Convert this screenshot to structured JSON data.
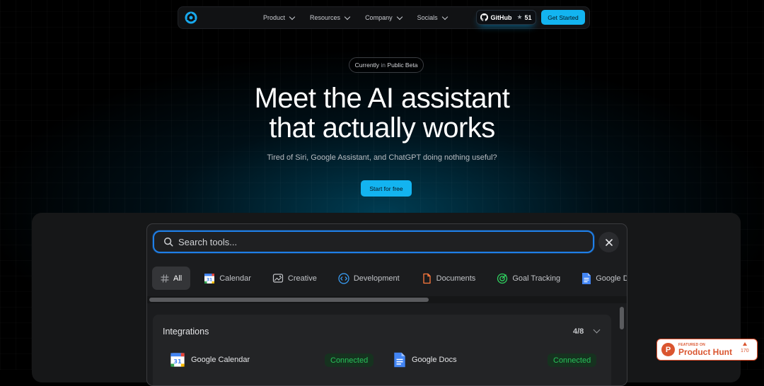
{
  "nav": {
    "menu": [
      {
        "label": "Product"
      },
      {
        "label": "Resources"
      },
      {
        "label": "Company"
      },
      {
        "label": "Socials"
      }
    ],
    "github_label": "GitHub",
    "github_stars": "51",
    "get_started": "Get Started"
  },
  "hero": {
    "badge_prefix": "Currently",
    "badge_mid": "in",
    "badge_suffix": "Public Beta",
    "title_line1": "Meet the AI assistant",
    "title_line2": "that actually works",
    "subtitle": "Tired of Siri, Google Assistant, and ChatGPT doing nothing useful?",
    "cta": "Start for free"
  },
  "demo": {
    "search_placeholder": "Search tools...",
    "tabs": [
      {
        "label": "All",
        "icon": "hash-icon"
      },
      {
        "label": "Calendar",
        "icon": "calendar-icon"
      },
      {
        "label": "Creative",
        "icon": "image-edit-icon"
      },
      {
        "label": "Development",
        "icon": "code-icon"
      },
      {
        "label": "Documents",
        "icon": "document-icon"
      },
      {
        "label": "Goal Tracking",
        "icon": "target-icon"
      },
      {
        "label": "Google Do",
        "icon": "google-docs-icon"
      }
    ],
    "section": {
      "title": "Integrations",
      "count": "4/8",
      "items": [
        {
          "name": "Google Calendar",
          "status": "Connected"
        },
        {
          "name": "Google Docs",
          "status": "Connected"
        }
      ]
    }
  },
  "product_hunt": {
    "featured": "FEATURED ON",
    "name": "Product Hunt",
    "count": "170"
  },
  "colors": {
    "accent": "#13b4f0",
    "focus": "#1f7fe8",
    "connected": "#28c25a",
    "product_hunt": "#da552f"
  }
}
